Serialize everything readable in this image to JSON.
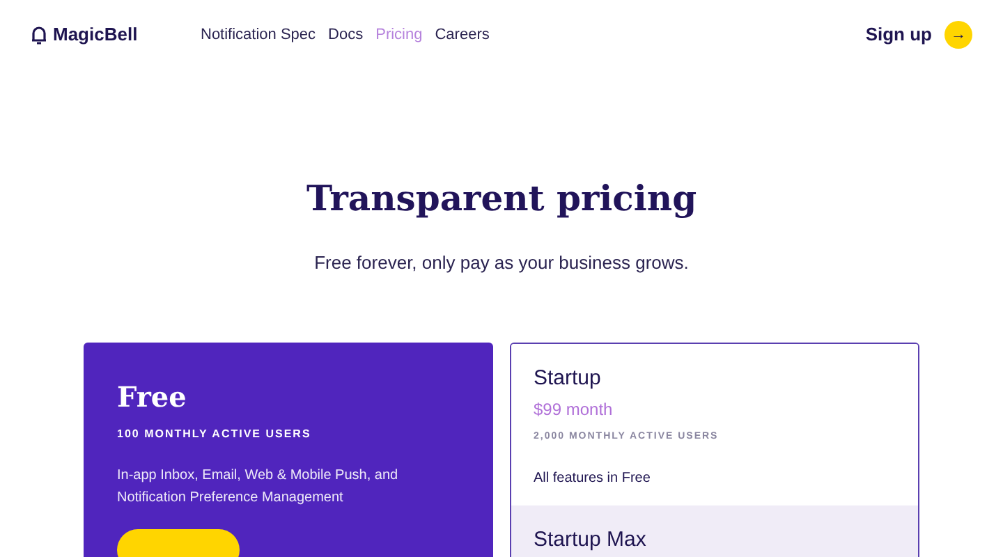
{
  "brand": "MagicBell",
  "nav": [
    {
      "label": "Notification Spec",
      "selected": false
    },
    {
      "label": "Docs",
      "selected": false
    },
    {
      "label": "Pricing",
      "selected": true
    },
    {
      "label": "Careers",
      "selected": false
    }
  ],
  "signup": {
    "label": "Sign up",
    "icon": "→"
  },
  "hero": {
    "title": "Transparent pricing",
    "subtitle": "Free forever, only pay as your business grows."
  },
  "free_plan": {
    "name": "Free",
    "users": "100 MONTHLY ACTIVE USERS",
    "description": "In-app Inbox, Email, Web & Mobile Push, and Notification Preference Management"
  },
  "paid_plans": [
    {
      "name": "Startup",
      "price": "$99 month",
      "users": "2,000 MONTHLY ACTIVE USERS",
      "features": "All features in Free",
      "selected": false
    },
    {
      "name": "Startup Max",
      "selected": true
    }
  ]
}
